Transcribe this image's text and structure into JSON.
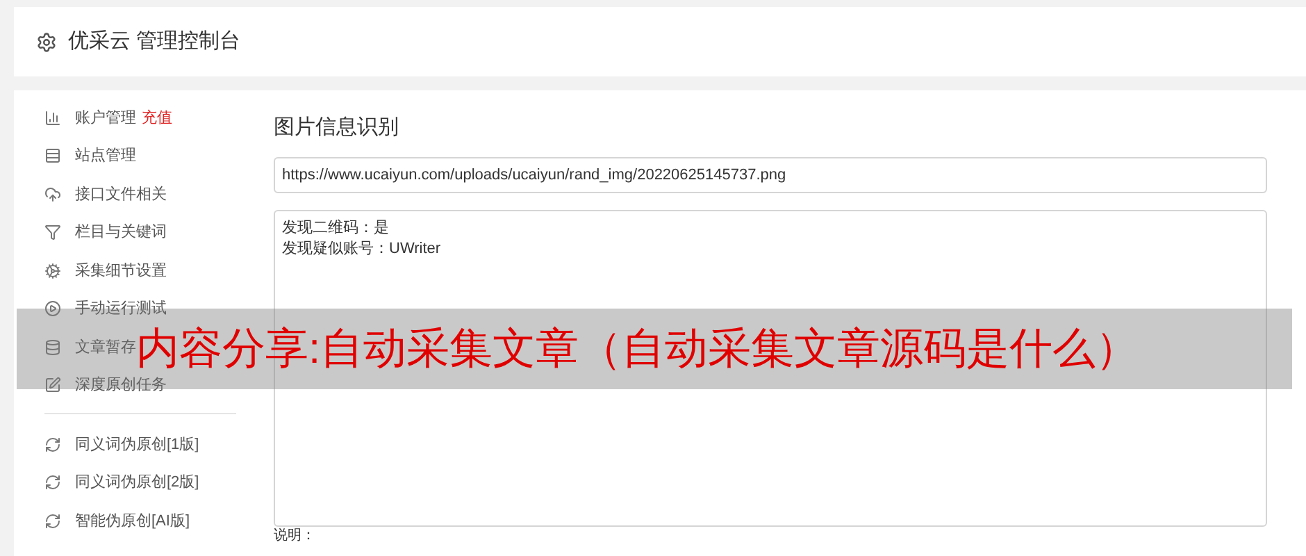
{
  "header": {
    "title": "优采云 管理控制台"
  },
  "sidebar": {
    "groups": [
      {
        "items": [
          {
            "label": "账户管理",
            "badge": "充值"
          },
          {
            "label": "站点管理"
          },
          {
            "label": "接口文件相关"
          },
          {
            "label": "栏目与关键词"
          },
          {
            "label": "采集细节设置"
          },
          {
            "label": "手动运行测试"
          },
          {
            "label": "文章暂存"
          },
          {
            "label": "深度原创任务"
          }
        ]
      },
      {
        "items": [
          {
            "label": "同义词伪原创[1版]"
          },
          {
            "label": "同义词伪原创[2版]"
          },
          {
            "label": "智能伪原创[AI版]"
          }
        ]
      }
    ]
  },
  "main": {
    "heading": "图片信息识别",
    "url_field": {
      "value": "https://www.ucaiyun.com/uploads/ucaiyun/rand_img/20220625145737.png"
    },
    "result_box": {
      "lines": [
        "发现二维码：是",
        "发现疑似账号：UWriter"
      ]
    },
    "note_label": "说明："
  },
  "banner": {
    "text": "内容分享:自动采集文章（自动采集文章源码是什么）"
  }
}
